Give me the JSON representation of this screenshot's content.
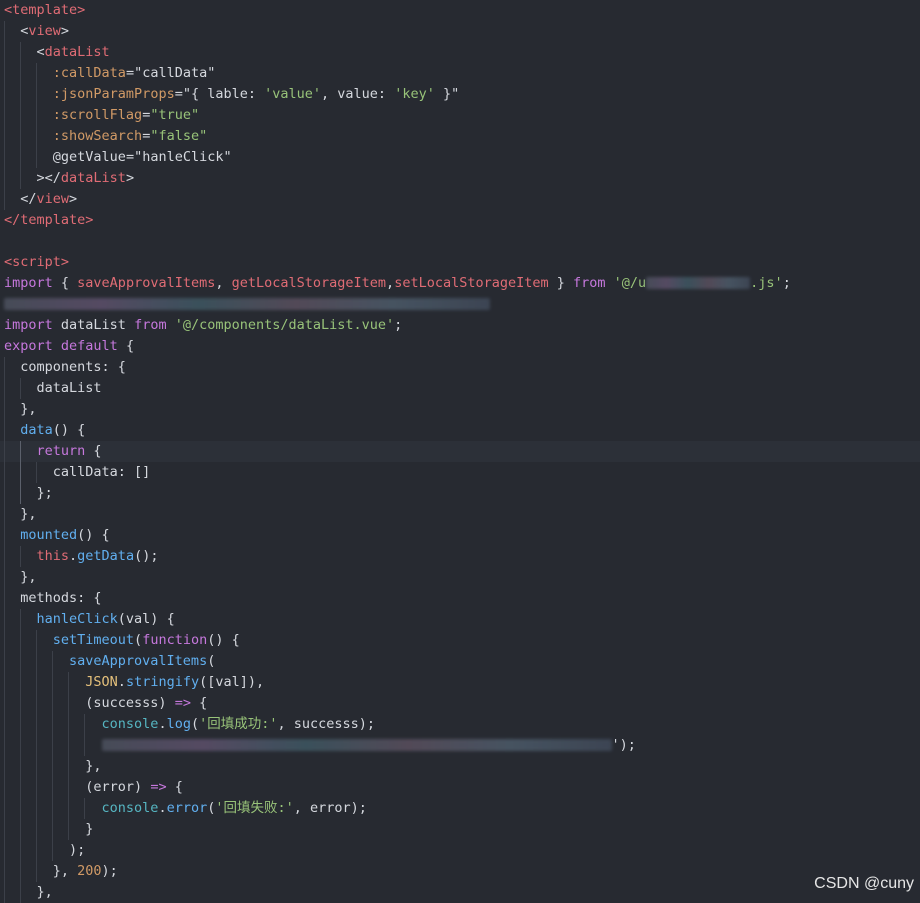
{
  "watermark": "CSDN @cuny",
  "code": {
    "l1": {
      "open": "<",
      "name": "template",
      "close": ">"
    },
    "l2": {
      "open": "<",
      "name": "view",
      "close": ">"
    },
    "l3": {
      "open": "<",
      "name": "dataList"
    },
    "l4": {
      "attr": ":callData",
      "eq": "=",
      "val": "\"callData\""
    },
    "l5": {
      "attr": ":jsonParamProps",
      "eq": "=",
      "q1": "\"{ lable: ",
      "s1": "'value'",
      "mid": ", value: ",
      "s2": "'key'",
      "q2": " }\""
    },
    "l6": {
      "attr": ":scrollFlag",
      "eq": "=",
      "val": "\"true\""
    },
    "l7": {
      "attr": ":showSearch",
      "eq": "=",
      "val": "\"false\""
    },
    "l8": {
      "attr": "@getValue",
      "eq": "=",
      "val": "\"hanleClick\""
    },
    "l9": {
      "open": "></",
      "name": "dataList",
      "close": ">"
    },
    "l10": {
      "open": "</",
      "name": "view",
      "close": ">"
    },
    "l11": {
      "open": "</",
      "name": "template",
      "close": ">"
    },
    "l13": {
      "open": "<",
      "name": "script",
      "close": ">"
    },
    "l14": {
      "kw": "import",
      "p1": " { ",
      "f1": "saveApprovalItems",
      "c1": ", ",
      "f2": "getLocalStorageItem",
      "c2": ",",
      "f3": "setLocalStorageItem",
      "p2": " } ",
      "kw2": "from",
      "s1": " '@/u",
      "s2": ".js'",
      "semi": ";"
    },
    "l16": {
      "kw": "import",
      "name": " dataList ",
      "kw2": "from",
      "str": " '@/components/dataList.vue'",
      "semi": ";"
    },
    "l17": {
      "kw": "export",
      "kw2": " default",
      "rest": " {"
    },
    "l18": {
      "text": "  components: {"
    },
    "l19": {
      "text": "    dataList"
    },
    "l20": {
      "text": "  },"
    },
    "l21": {
      "fn": "  data",
      "rest": "() {"
    },
    "l22": {
      "kw": "    return",
      "rest": " {"
    },
    "l23": {
      "text": "      callData: []"
    },
    "l24": {
      "text": "    };"
    },
    "l25": {
      "text": "  },"
    },
    "l26": {
      "fn": "  mounted",
      "rest": "() {"
    },
    "l27": {
      "kw": "    this",
      "dot": ".",
      "fn": "getData",
      "rest": "();"
    },
    "l28": {
      "text": "  },"
    },
    "l29": {
      "text": "  methods: {"
    },
    "l30": {
      "fn": "    hanleClick",
      "rest": "(val) {"
    },
    "l31": {
      "fn": "      setTimeout",
      "p": "(",
      "kw": "function",
      "rest": "() {"
    },
    "l32": {
      "fn": "        saveApprovalItems",
      "rest": "("
    },
    "l33": {
      "cls": "          JSON",
      "dot": ".",
      "fn": "stringify",
      "rest": "([val]),"
    },
    "l34": {
      "p": "          (successs) ",
      "arrow": "=>",
      "rest": " {"
    },
    "l35": {
      "obj": "            console",
      "dot": ".",
      "fn": "log",
      "p": "(",
      "str": "'回填成功:'",
      "rest": ", successs);"
    },
    "l36": {
      "tail": "');"
    },
    "l37": {
      "text": "          },"
    },
    "l38": {
      "p": "          (error) ",
      "arrow": "=>",
      "rest": " {"
    },
    "l39": {
      "obj": "            console",
      "dot": ".",
      "fn": "error",
      "p": "(",
      "str": "'回填失败:'",
      "rest": ", error);"
    },
    "l40": {
      "text": "          }"
    },
    "l41": {
      "text": "        );"
    },
    "l42": {
      "p": "      }, ",
      "num": "200",
      "rest": ");"
    },
    "l43": {
      "text": "    },"
    }
  }
}
